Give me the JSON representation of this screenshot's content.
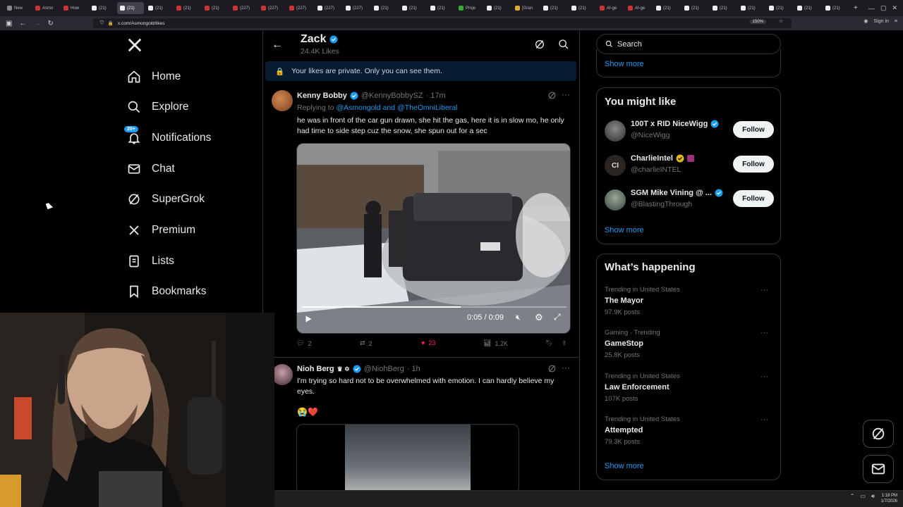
{
  "browser": {
    "tabs": [
      "New",
      "Asmo",
      "How",
      "(21)",
      "(21)",
      "(21)",
      "(21)",
      "(21)",
      "(227)",
      "(227)",
      "(227)",
      "(227)",
      "(227)",
      "(21)",
      "(21)",
      "(21)",
      "Proje",
      "(21)",
      "[Gran",
      "(21)",
      "(21)",
      "AI-ge",
      "AI-ge",
      "(21)",
      "(21)",
      "(21)",
      "(21)",
      "(21)",
      "(21)",
      "(21)"
    ],
    "url": "x.com/Asmongold/likes",
    "zoom": "150%",
    "sign_in": "Sign in"
  },
  "nav": {
    "logo": "X",
    "items": [
      {
        "label": "Home",
        "icon": "home-icon"
      },
      {
        "label": "Explore",
        "icon": "search-icon"
      },
      {
        "label": "Notifications",
        "icon": "bell-icon",
        "badge": "20+"
      },
      {
        "label": "Chat",
        "icon": "mail-icon"
      },
      {
        "label": "SuperGrok",
        "icon": "grok-icon"
      },
      {
        "label": "Premium",
        "icon": "x-icon"
      },
      {
        "label": "Lists",
        "icon": "list-icon"
      },
      {
        "label": "Bookmarks",
        "icon": "bookmark-icon"
      }
    ]
  },
  "profile": {
    "name": "Zack",
    "likes": "24.4K Likes"
  },
  "private_notice": "Your likes are private. Only you can see them.",
  "tweets": [
    {
      "name": "Kenny Bobby",
      "handle": "@KennyBobbySZ",
      "time": "· 17m",
      "reply_prefix": "Replying to",
      "reply_to": "@Asmongold and @TheOmniLiberal",
      "text": "he was in front of the car gun drawn, she hit the gas, here it is in slow mo, he only had time to side step cuz the snow, she spun out for a sec",
      "video_time": "0:05 / 0:09",
      "video_progress": 0.6,
      "replies": "2",
      "reposts": "2",
      "likes": "23",
      "views": "1.2K"
    },
    {
      "name": "Nioh Berg",
      "name_emojis": "♛ ✡",
      "handle": "@NiohBerg",
      "time": "· 1h",
      "text": "I'm trying so hard not to be overwhelmed with emotion. I can hardly believe my eyes.",
      "emojis": "😭❤️"
    }
  ],
  "search": {
    "placeholder": "Search"
  },
  "top_show_more": "Show more",
  "suggestions": {
    "title": "You might like",
    "items": [
      {
        "name": "100T x RID NiceWigg",
        "handle": "@NiceWigg",
        "button": "Follow"
      },
      {
        "name": "CharlieIntel",
        "handle": "@charlieINTEL",
        "button": "Follow"
      },
      {
        "name": "SGM Mike Vining @ ...",
        "handle": "@BlastingThrough",
        "button": "Follow"
      }
    ],
    "show_more": "Show more"
  },
  "trends": {
    "title": "What’s happening",
    "items": [
      {
        "context": "Trending in United States",
        "topic": "The Mayor",
        "count": "97.9K posts"
      },
      {
        "context": "Gaming · Trending",
        "topic": "GameStop",
        "count": "25.8K posts"
      },
      {
        "context": "Trending in United States",
        "topic": "Law Enforcement",
        "count": "107K posts"
      },
      {
        "context": "Trending in United States",
        "topic": "Attempted",
        "count": "79.3K posts"
      }
    ],
    "show_more": "Show more"
  },
  "taskbar": {
    "time": "1:18 PM",
    "date": "1/7/2026"
  },
  "colors": {
    "accent": "#1d9bf0",
    "like": "#f91880",
    "bg": "#000000",
    "border": "#2f3336",
    "muted": "#71767b"
  }
}
